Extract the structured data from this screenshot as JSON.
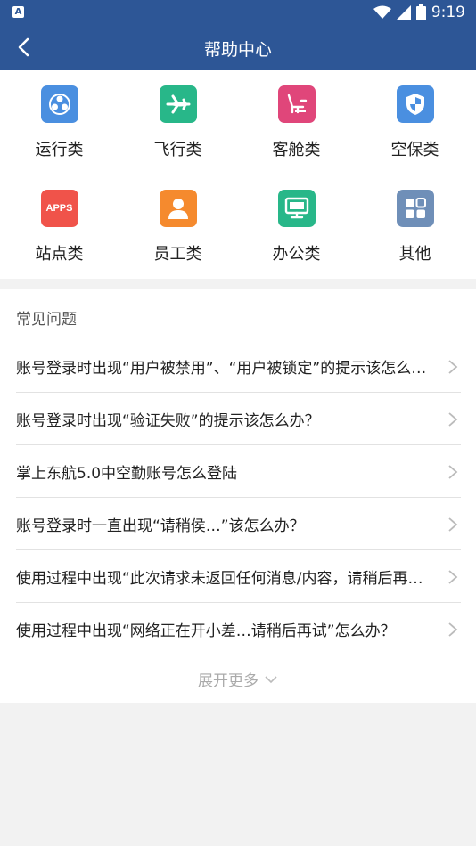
{
  "status_bar": {
    "app_badge": "A",
    "time": "9:19",
    "battery_level": "9"
  },
  "nav": {
    "title": "帮助中心"
  },
  "categories": [
    {
      "label": "运行类",
      "icon": "operations-icon",
      "color": "#4a8fe0"
    },
    {
      "label": "飞行类",
      "icon": "airplane-icon",
      "color": "#28b789"
    },
    {
      "label": "客舱类",
      "icon": "seat-icon",
      "color": "#e0467a"
    },
    {
      "label": "空保类",
      "icon": "shield-icon",
      "color": "#4a8fe0"
    },
    {
      "label": "站点类",
      "icon": "apps-icon",
      "icon_text": "APPS",
      "color": "#f0534a"
    },
    {
      "label": "员工类",
      "icon": "person-icon",
      "color": "#f58a2e"
    },
    {
      "label": "办公类",
      "icon": "monitor-icon",
      "color": "#28b789"
    },
    {
      "label": "其他",
      "icon": "grid-icon",
      "color": "#6f8fb8"
    }
  ],
  "faq": {
    "heading": "常见问题",
    "items": [
      "账号登录时出现“用户被禁用”、“用户被锁定”的提示该怎么办？",
      "账号登录时出现“验证失败”的提示该怎么办？",
      "掌上东航5.0中空勤账号怎么登陆",
      "账号登录时一直出现“请稍侯…”该怎么办？",
      "使用过程中出现“此次请求未返回任何消息/内容，请稍后再试”怎么办？",
      "使用过程中出现“网络正在开小差…请稍后再试”怎么办？"
    ],
    "more_label": "展开更多"
  }
}
